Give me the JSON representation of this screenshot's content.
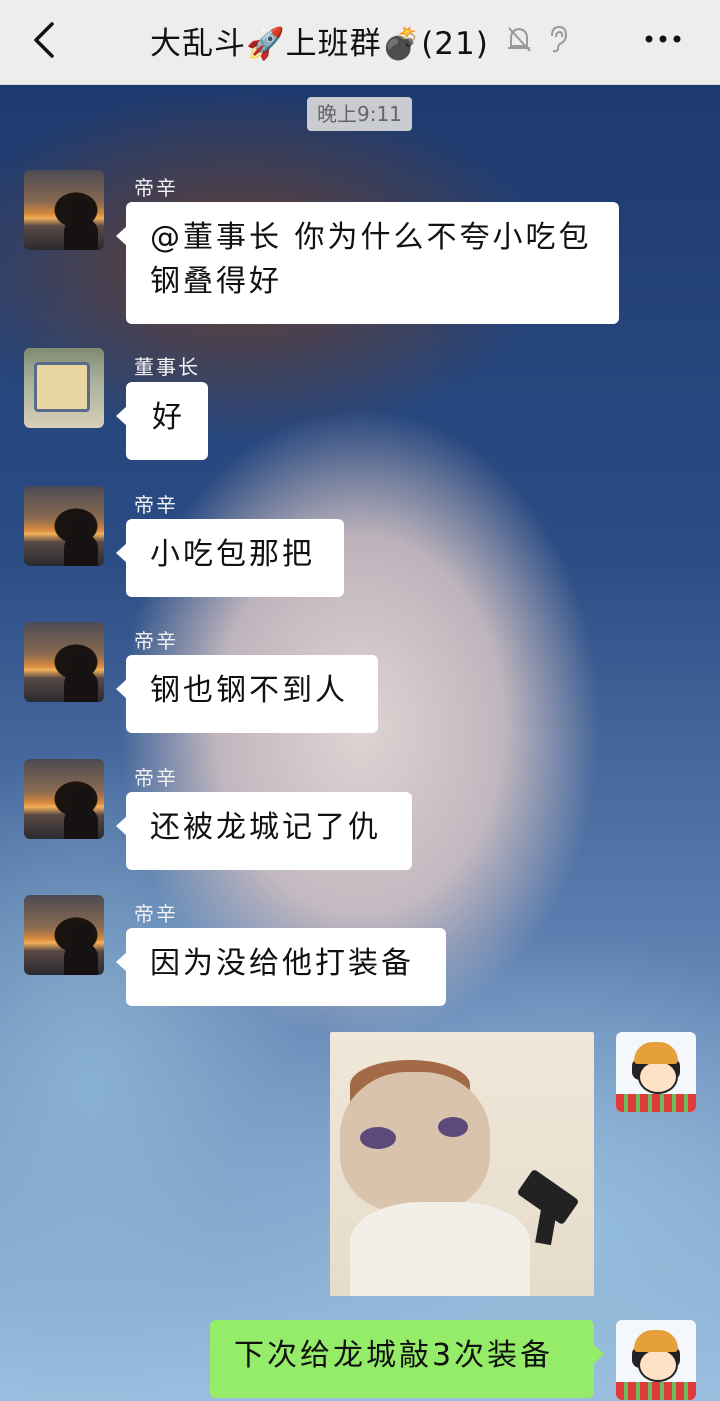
{
  "header": {
    "title": "大乱斗🚀上班群💣(21)",
    "back_icon": "chevron-left-icon",
    "mute_icon": "bell-slash-icon",
    "ear_icon": "ear-icon",
    "more_icon": "more-dots-icon"
  },
  "timestamp": "晚上9:11",
  "messages": [
    {
      "sender": "帝辛",
      "text_line1": "@董事长  你为什么不夸小吃包",
      "text_line2": "钢叠得好"
    },
    {
      "sender": "董事长",
      "text": "好"
    },
    {
      "sender": "帝辛",
      "text": "小吃包那把"
    },
    {
      "sender": "帝辛",
      "text": "钢也钢不到人"
    },
    {
      "sender": "帝辛",
      "text": "还被龙城记了仇"
    },
    {
      "sender": "帝辛",
      "text": "因为没给他打装备"
    }
  ],
  "self_messages": [
    {
      "type": "image",
      "description_icon": "cat-with-gun-meme-image"
    },
    {
      "type": "text",
      "text": "下次给龙城敲3次装备"
    }
  ],
  "colors": {
    "header_bg": "#ededed",
    "bubble_left": "#ffffff",
    "bubble_right": "#95ec69"
  }
}
